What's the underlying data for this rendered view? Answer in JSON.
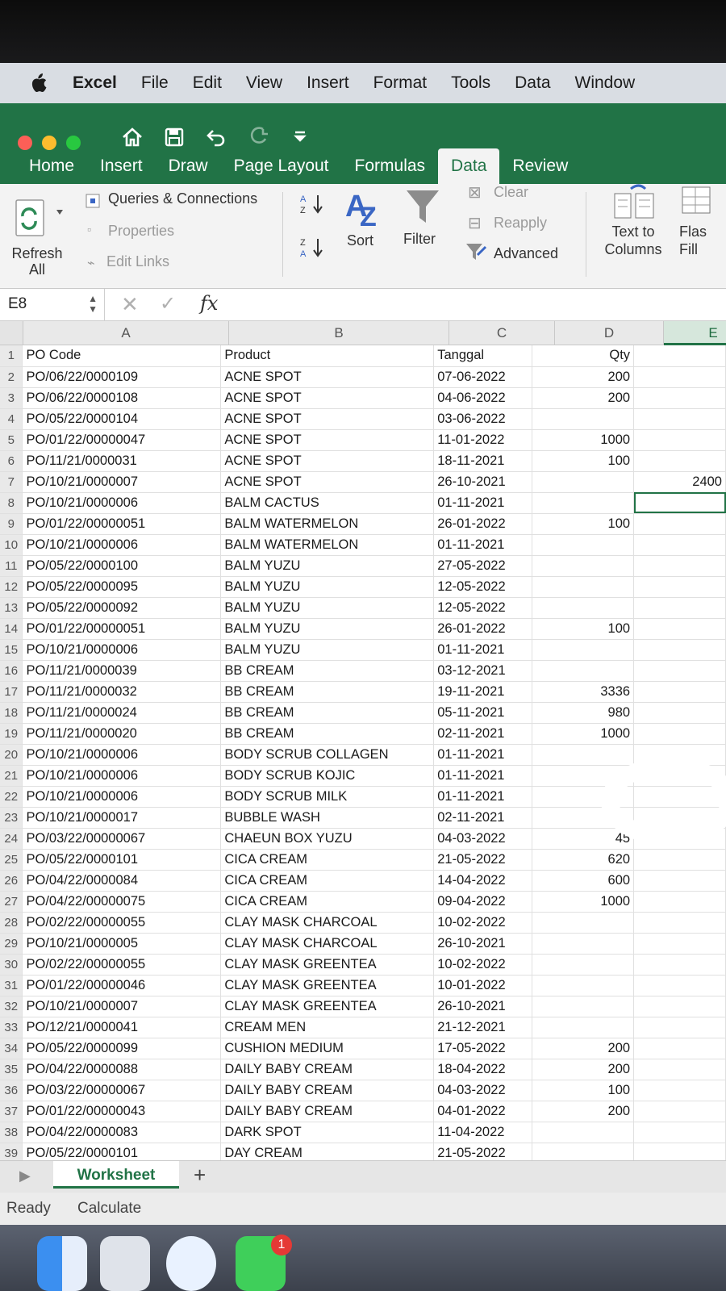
{
  "menubar": {
    "app": "Excel",
    "items": [
      "File",
      "Edit",
      "View",
      "Insert",
      "Format",
      "Tools",
      "Data",
      "Window"
    ]
  },
  "ribbon_tabs": [
    "Home",
    "Insert",
    "Draw",
    "Page Layout",
    "Formulas",
    "Data",
    "Review"
  ],
  "active_tab": "Data",
  "ribbon": {
    "refresh_all": "Refresh All",
    "queries_connections": "Queries & Connections",
    "properties": "Properties",
    "edit_links": "Edit Links",
    "sort": "Sort",
    "filter": "Filter",
    "clear": "Clear",
    "reapply": "Reapply",
    "advanced": "Advanced",
    "text_to_columns": "Text to Columns",
    "flash_fill": "Flas Fill"
  },
  "formula_bar": {
    "name_box": "E8",
    "fx": "fx",
    "cancel_symbol": "✕",
    "enter_symbol": "✓"
  },
  "columns": [
    "A",
    "B",
    "C",
    "D",
    "E"
  ],
  "selected_cell": "E8",
  "rows": [
    {
      "n": "1",
      "a": "PO Code",
      "b": "Product",
      "c": "Tanggal",
      "d": "Qty",
      "e": ""
    },
    {
      "n": "2",
      "a": "PO/06/22/0000109",
      "b": "ACNE SPOT",
      "c": "07-06-2022",
      "d": "200",
      "e": ""
    },
    {
      "n": "3",
      "a": "PO/06/22/0000108",
      "b": "ACNE SPOT",
      "c": "04-06-2022",
      "d": "200",
      "e": ""
    },
    {
      "n": "4",
      "a": "PO/05/22/0000104",
      "b": "ACNE SPOT",
      "c": "03-06-2022",
      "d": "",
      "e": ""
    },
    {
      "n": "5",
      "a": "PO/01/22/00000047",
      "b": "ACNE SPOT",
      "c": "11-01-2022",
      "d": "1000",
      "e": ""
    },
    {
      "n": "6",
      "a": "PO/11/21/0000031",
      "b": "ACNE SPOT",
      "c": "18-11-2021",
      "d": "100",
      "e": ""
    },
    {
      "n": "7",
      "a": "PO/10/21/0000007",
      "b": "ACNE SPOT",
      "c": "26-10-2021",
      "d": "",
      "e": "2400"
    },
    {
      "n": "8",
      "a": "PO/10/21/0000006",
      "b": "BALM CACTUS",
      "c": "01-11-2021",
      "d": "",
      "e": ""
    },
    {
      "n": "9",
      "a": "PO/01/22/00000051",
      "b": "BALM WATERMELON",
      "c": "26-01-2022",
      "d": "100",
      "e": ""
    },
    {
      "n": "10",
      "a": "PO/10/21/0000006",
      "b": "BALM WATERMELON",
      "c": "01-11-2021",
      "d": "",
      "e": ""
    },
    {
      "n": "11",
      "a": "PO/05/22/0000100",
      "b": "BALM YUZU",
      "c": "27-05-2022",
      "d": "",
      "e": ""
    },
    {
      "n": "12",
      "a": "PO/05/22/0000095",
      "b": "BALM YUZU",
      "c": "12-05-2022",
      "d": "",
      "e": ""
    },
    {
      "n": "13",
      "a": "PO/05/22/0000092",
      "b": "BALM YUZU",
      "c": "12-05-2022",
      "d": "",
      "e": ""
    },
    {
      "n": "14",
      "a": "PO/01/22/00000051",
      "b": "BALM YUZU",
      "c": "26-01-2022",
      "d": "100",
      "e": ""
    },
    {
      "n": "15",
      "a": "PO/10/21/0000006",
      "b": "BALM YUZU",
      "c": "01-11-2021",
      "d": "",
      "e": ""
    },
    {
      "n": "16",
      "a": "PO/11/21/0000039",
      "b": "BB CREAM",
      "c": "03-12-2021",
      "d": "",
      "e": ""
    },
    {
      "n": "17",
      "a": "PO/11/21/0000032",
      "b": "BB CREAM",
      "c": "19-11-2021",
      "d": "3336",
      "e": ""
    },
    {
      "n": "18",
      "a": "PO/11/21/0000024",
      "b": "BB CREAM",
      "c": "05-11-2021",
      "d": "980",
      "e": ""
    },
    {
      "n": "19",
      "a": "PO/11/21/0000020",
      "b": "BB CREAM",
      "c": "02-11-2021",
      "d": "1000",
      "e": ""
    },
    {
      "n": "20",
      "a": "PO/10/21/0000006",
      "b": "BODY SCRUB COLLAGEN",
      "c": "01-11-2021",
      "d": "",
      "e": ""
    },
    {
      "n": "21",
      "a": "PO/10/21/0000006",
      "b": "BODY SCRUB KOJIC",
      "c": "01-11-2021",
      "d": "",
      "e": ""
    },
    {
      "n": "22",
      "a": "PO/10/21/0000006",
      "b": "BODY SCRUB MILK",
      "c": "01-11-2021",
      "d": "",
      "e": ""
    },
    {
      "n": "23",
      "a": "PO/10/21/0000017",
      "b": "BUBBLE WASH",
      "c": "02-11-2021",
      "d": "",
      "e": ""
    },
    {
      "n": "24",
      "a": "PO/03/22/00000067",
      "b": "CHAEUN BOX YUZU",
      "c": "04-03-2022",
      "d": "45",
      "e": ""
    },
    {
      "n": "25",
      "a": "PO/05/22/0000101",
      "b": "CICA CREAM",
      "c": "21-05-2022",
      "d": "620",
      "e": ""
    },
    {
      "n": "26",
      "a": "PO/04/22/0000084",
      "b": "CICA CREAM",
      "c": "14-04-2022",
      "d": "600",
      "e": ""
    },
    {
      "n": "27",
      "a": "PO/04/22/00000075",
      "b": "CICA CREAM",
      "c": "09-04-2022",
      "d": "1000",
      "e": ""
    },
    {
      "n": "28",
      "a": "PO/02/22/00000055",
      "b": "CLAY MASK CHARCOAL",
      "c": "10-02-2022",
      "d": "",
      "e": ""
    },
    {
      "n": "29",
      "a": "PO/10/21/0000005",
      "b": "CLAY MASK CHARCOAL",
      "c": "26-10-2021",
      "d": "",
      "e": ""
    },
    {
      "n": "30",
      "a": "PO/02/22/00000055",
      "b": "CLAY MASK GREENTEA",
      "c": "10-02-2022",
      "d": "",
      "e": ""
    },
    {
      "n": "31",
      "a": "PO/01/22/00000046",
      "b": "CLAY MASK GREENTEA",
      "c": "10-01-2022",
      "d": "",
      "e": ""
    },
    {
      "n": "32",
      "a": "PO/10/21/0000007",
      "b": "CLAY MASK GREENTEA",
      "c": "26-10-2021",
      "d": "",
      "e": ""
    },
    {
      "n": "33",
      "a": "PO/12/21/0000041",
      "b": "CREAM MEN",
      "c": "21-12-2021",
      "d": "",
      "e": ""
    },
    {
      "n": "34",
      "a": "PO/05/22/0000099",
      "b": "CUSHION MEDIUM",
      "c": "17-05-2022",
      "d": "200",
      "e": ""
    },
    {
      "n": "35",
      "a": "PO/04/22/0000088",
      "b": "DAILY BABY CREAM",
      "c": "18-04-2022",
      "d": "200",
      "e": ""
    },
    {
      "n": "36",
      "a": "PO/03/22/00000067",
      "b": "DAILY BABY CREAM",
      "c": "04-03-2022",
      "d": "100",
      "e": ""
    },
    {
      "n": "37",
      "a": "PO/01/22/00000043",
      "b": "DAILY BABY CREAM",
      "c": "04-01-2022",
      "d": "200",
      "e": ""
    },
    {
      "n": "38",
      "a": "PO/04/22/0000083",
      "b": "DARK SPOT",
      "c": "11-04-2022",
      "d": "",
      "e": ""
    },
    {
      "n": "39",
      "a": "PO/05/22/0000101",
      "b": "DAY CREAM",
      "c": "21-05-2022",
      "d": "",
      "e": ""
    }
  ],
  "sheet_tabs": {
    "active": "Worksheet",
    "add": "+"
  },
  "status": {
    "ready": "Ready",
    "calculate": "Calculate"
  },
  "dock": {
    "badge": "1"
  },
  "colors": {
    "excel_green": "#217346",
    "ribbon_bg": "#f3f3f3"
  }
}
